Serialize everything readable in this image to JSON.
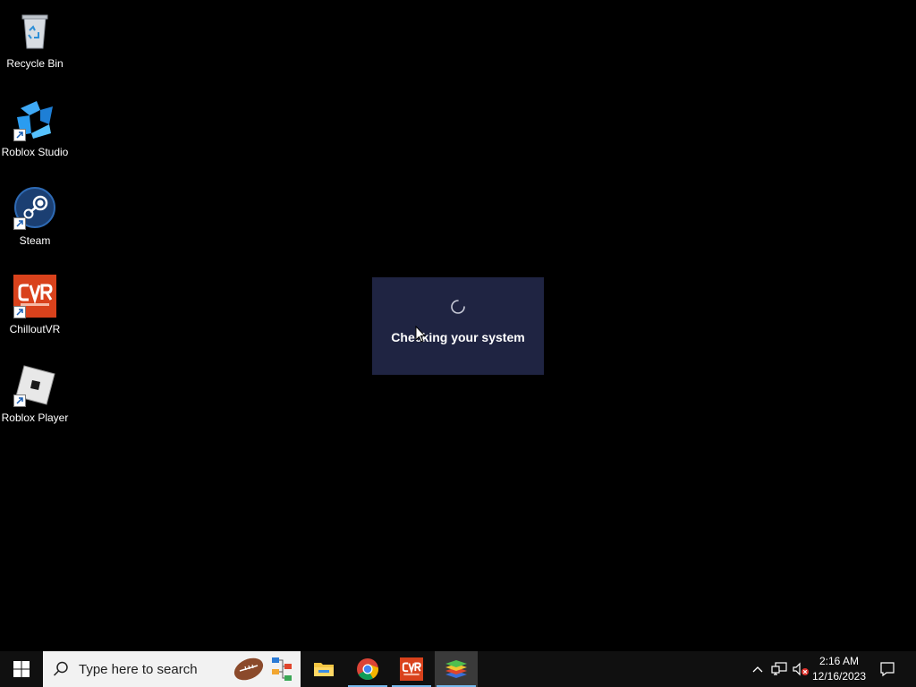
{
  "desktop_icons": [
    {
      "label": "Recycle Bin",
      "icon": "recycle-bin-icon",
      "shortcut": false
    },
    {
      "label": "Roblox Studio",
      "icon": "roblox-studio-icon",
      "shortcut": true
    },
    {
      "label": "Steam",
      "icon": "steam-icon",
      "shortcut": true
    },
    {
      "label": "ChilloutVR",
      "icon": "chilloutvr-icon",
      "shortcut": true
    },
    {
      "label": "Roblox Player",
      "icon": "roblox-player-icon",
      "shortcut": true
    }
  ],
  "loader": {
    "message": "Checking your system",
    "spinner": "loading-spinner-icon"
  },
  "taskbar": {
    "search_placeholder": "Type here to search",
    "apps": [
      {
        "name": "File Explorer",
        "icon": "file-explorer-icon",
        "active": false,
        "running": false
      },
      {
        "name": "Google Chrome",
        "icon": "chrome-icon",
        "active": false,
        "running": true
      },
      {
        "name": "ChilloutVR",
        "icon": "chilloutvr-icon",
        "active": false,
        "running": true
      },
      {
        "name": "BlueStacks",
        "icon": "bluestacks-icon",
        "active": true,
        "running": true
      }
    ],
    "tray": {
      "time": "2:16 AM",
      "date": "12/16/2023",
      "icons": [
        "chevron-up-icon",
        "network-icon",
        "volume-muted-icon",
        "notification-icon"
      ]
    }
  },
  "colors": {
    "desktop_bg": "#000000",
    "taskbar_bg": "#101010",
    "loader_bg": "#1f2442",
    "accent": "#76b9ed"
  }
}
